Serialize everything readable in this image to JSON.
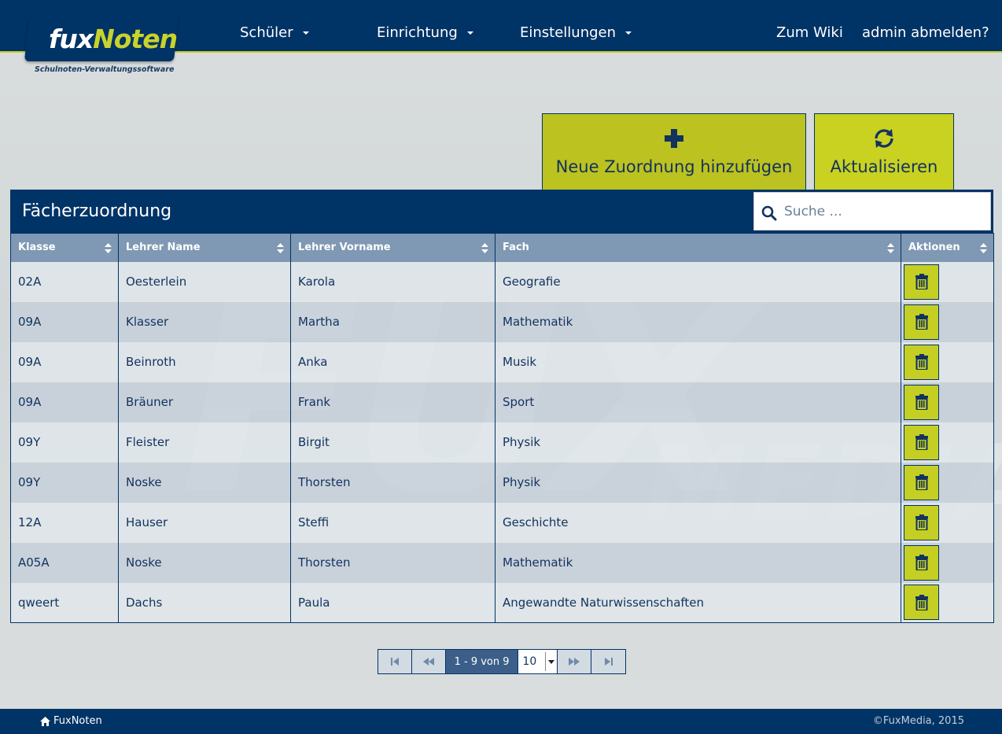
{
  "brand": {
    "logo_part1": "fux",
    "logo_part2": "Noten",
    "tagline": "Schulnoten-Verwaltungssoftware",
    "primary_color": "#003366",
    "accent_color": "#c5cf23"
  },
  "nav": {
    "items": [
      {
        "label": "Schüler",
        "icon": "caret-down-icon"
      },
      {
        "label": "Einrichtung",
        "icon": "caret-down-icon"
      },
      {
        "label": "Einstellungen",
        "icon": "caret-down-icon"
      }
    ],
    "wiki": "Zum Wiki",
    "logout": "admin abmelden?"
  },
  "actions": {
    "add_label": "Neue Zuordnung hinzufügen",
    "add_icon": "plus-icon",
    "refresh_label": "Aktualisieren",
    "refresh_icon": "refresh-icon"
  },
  "panel": {
    "title": "Fächerzuordnung",
    "search_placeholder": "Suche ..."
  },
  "table": {
    "columns": [
      "Klasse",
      "Lehrer Name",
      "Lehrer Vorname",
      "Fach",
      "Aktionen"
    ],
    "rows": [
      [
        "02A",
        "Oesterlein",
        "Karola",
        "Geografie"
      ],
      [
        "09A",
        "Klasser",
        "Martha",
        "Mathematik"
      ],
      [
        "09A",
        "Beinroth",
        "Anka",
        "Musik"
      ],
      [
        "09A",
        "Bräuner",
        "Frank",
        "Sport"
      ],
      [
        "09Y",
        "Fleister",
        "Birgit",
        "Physik"
      ],
      [
        "09Y",
        "Noske",
        "Thorsten",
        "Physik"
      ],
      [
        "12A",
        "Hauser",
        "Steffi",
        "Geschichte"
      ],
      [
        "A05A",
        "Noske",
        "Thorsten",
        "Mathematik"
      ],
      [
        "qweert",
        "Dachs",
        "Paula",
        "Angewandte Naturwissenschaften"
      ]
    ],
    "row_action_icon": "trash-icon"
  },
  "pager": {
    "info": "1 - 9 von 9",
    "page_size": "10"
  },
  "footer": {
    "home_label": "FuxNoten",
    "copyright": "©FuxMedia, 2015"
  }
}
